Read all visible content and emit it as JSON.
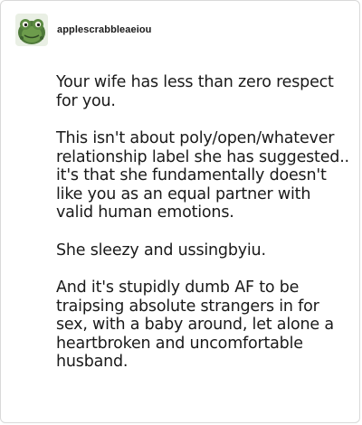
{
  "post": {
    "author": "applescrabbleaeiou",
    "avatar_icon": "green-frog-avatar-icon",
    "paragraphs": [
      "Your wife has less than zero respect for you.",
      "This isn't about poly/open/whatever relationship label she has suggested.. it's that she fundamentally doesn't like you as an equal partner with valid human emotions.",
      "She sleezy and ussingbyiu.",
      "And it's stupidly dumb AF to be traipsing absolute strangers in for sex, with a baby around, let alone a heartbroken and uncomfortable husband."
    ]
  }
}
